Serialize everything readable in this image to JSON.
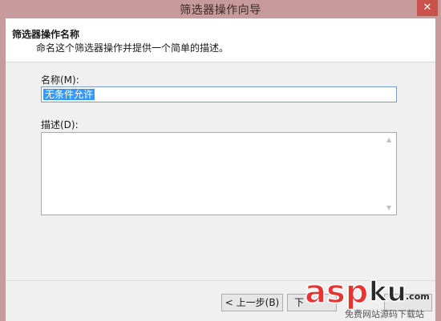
{
  "window": {
    "title": "筛选器操作向导",
    "close_glyph": "✕"
  },
  "header": {
    "title": "筛选器操作名称",
    "subtitle": "命名这个筛选器操作并提供一个简单的描述。"
  },
  "form": {
    "name_label": "名称(M):",
    "name_value": "无条件允许",
    "description_label": "描述(D):",
    "description_value": ""
  },
  "footer": {
    "back_label": "< 上一步(B)",
    "next_label_visible": "下",
    "cancel_label_visible": "",
    "scroll_up_glyph": "▲",
    "scroll_down_glyph": "▼"
  },
  "watermark": {
    "logo": "aspku",
    "com": "com",
    "slogan": "免费网站源码下载站"
  },
  "colors": {
    "title_bar": "#c79a9c",
    "selection": "#3399ff",
    "close_button": "#c9524d",
    "watermark_red": "#e8342e"
  }
}
